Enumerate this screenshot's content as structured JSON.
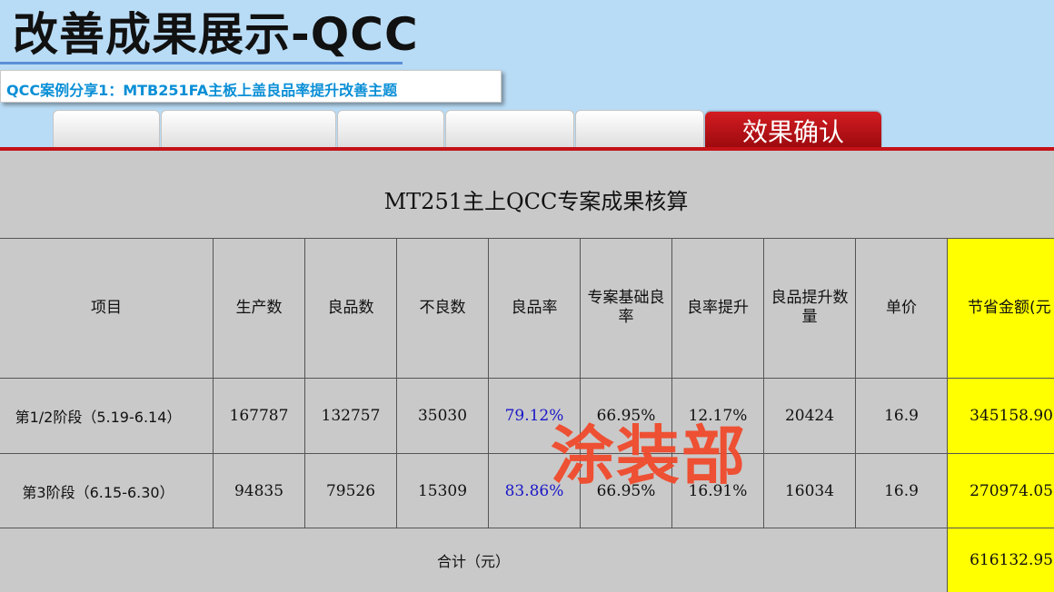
{
  "header": {
    "title": "改善成果展示-QCC",
    "subtitle": "QCC案例分享1：MTB251FA主板上盖良品率提升改善主题"
  },
  "tabs": [
    {
      "label": ""
    },
    {
      "label": ""
    },
    {
      "label": ""
    },
    {
      "label": ""
    },
    {
      "label": ""
    },
    {
      "label": "效果确认",
      "active": true
    }
  ],
  "colors": {
    "accent": "#c41218",
    "subtitle_text": "#0a8fd6",
    "highlight_column": "#ffff00",
    "rate_text": "#1a16c8",
    "watermark": "#f04a2c",
    "background": "#b9dcf6"
  },
  "table": {
    "title": "MT251主上QCC专案成果核算",
    "headers": [
      "项目",
      "生产数",
      "良品数",
      "不良数",
      "良品率",
      "专案基础良率",
      "良率提升",
      "良品提升数量",
      "单价",
      "节省金额(元"
    ],
    "rows": [
      [
        "第1/2阶段（5.19-6.14）",
        "167787",
        "132757",
        "35030",
        "79.12%",
        "66.95%",
        "12.17%",
        "20424",
        "16.9",
        "345158.90"
      ],
      [
        "第3阶段（6.15-6.30）",
        "94835",
        "79526",
        "15309",
        "83.86%",
        "66.95%",
        "16.91%",
        "16034",
        "16.9",
        "270974.05"
      ]
    ],
    "total_label": "合计（元）",
    "total_value": "616132.95"
  },
  "watermark": "涂装部"
}
